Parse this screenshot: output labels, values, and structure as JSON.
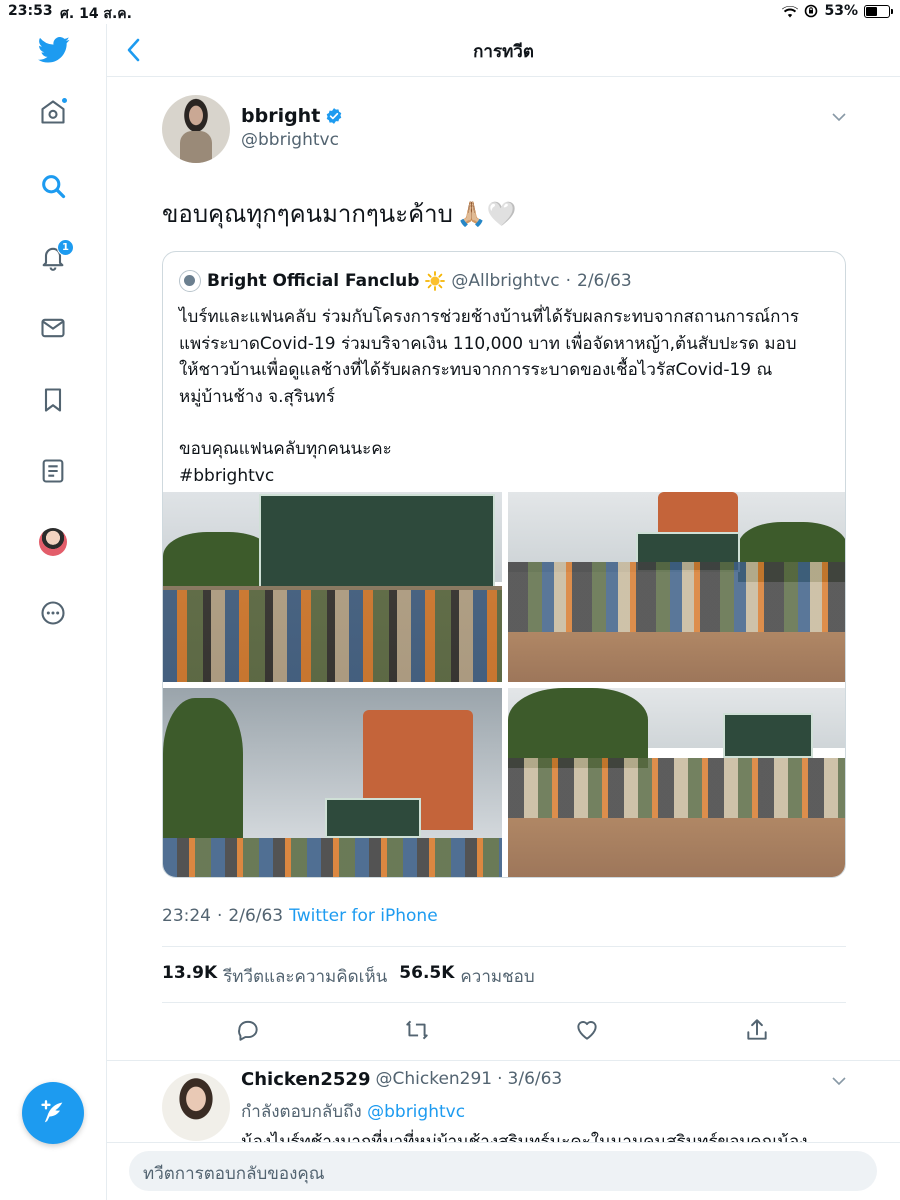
{
  "status_bar": {
    "time": "23:53",
    "date": "ศ. 14 ส.ค.",
    "battery": "53%",
    "battery_level": 0.53
  },
  "header": {
    "title": "การทวีต"
  },
  "sidebar": {
    "items": [
      {
        "icon": "home-icon"
      },
      {
        "icon": "search-icon"
      },
      {
        "icon": "bell-icon",
        "badge": "1"
      },
      {
        "icon": "mail-icon"
      },
      {
        "icon": "bookmark-icon"
      },
      {
        "icon": "list-icon"
      },
      {
        "icon": "profile-avatar"
      },
      {
        "icon": "more-icon"
      }
    ],
    "compose_icon": "feather-plus-icon"
  },
  "tweet": {
    "name": "bbright",
    "handle": "@bbrightvc",
    "text": "ขอบคุณทุกๆคนมากๆนะค้าบ",
    "emoji": "🙏🏼🤍",
    "quote": {
      "name": "Bright Official Fanclub",
      "handle": "@Allbrightvc",
      "separator": "·",
      "date": "2/6/63",
      "lines": [
        "ไบร์ทและแฟนคลับ ร่วมกับโครงการช่วยช้างบ้านที่ได้รับผลกระทบจากสถานการณ์การ",
        "แพร่ระบาดCovid-19 ร่วมบริจาคเงิน 110,000 บาท เพื่อจัดหาหญ้า,ต้นสับปะรด มอบ",
        "ให้ชาวบ้านเพื่อดูแลช้างที่ได้รับผลกระทบจากการระบาดของเชื้อไวรัสCovid-19 ณ",
        "หมู่บ้านช้าง จ.สุรินทร์"
      ],
      "lines2": [
        "ขอบคุณแฟนคลับทุกคนนะคะ",
        "#bbrightvc"
      ]
    },
    "time": "23:24",
    "date_sep": "·",
    "date": "2/6/63",
    "source": "Twitter for iPhone",
    "retweets_count": "13.9K",
    "retweets_label": "รีทวีตและความคิดเห็น",
    "likes_count": "56.5K",
    "likes_label": "ความชอบ"
  },
  "reply": {
    "name": "Chicken2529",
    "handle": "@Chicken291",
    "separator": "·",
    "date": "3/6/63",
    "replying_prefix": "กำลังตอบกลับถึง",
    "replying_handle": "@bbrightvc",
    "text": "น้องไบร์ทช้างมากที่มาที่หมู่บ้านช้างสุรินทร์นะคะในนามคนสุรินทร์ขอบคุณน้อง"
  },
  "compose": {
    "placeholder": "ทวีตการตอบกลับของคุณ"
  },
  "colors": {
    "accent": "#1d9bf0",
    "secondary_text": "#536471",
    "border": "#e6ecf0"
  }
}
